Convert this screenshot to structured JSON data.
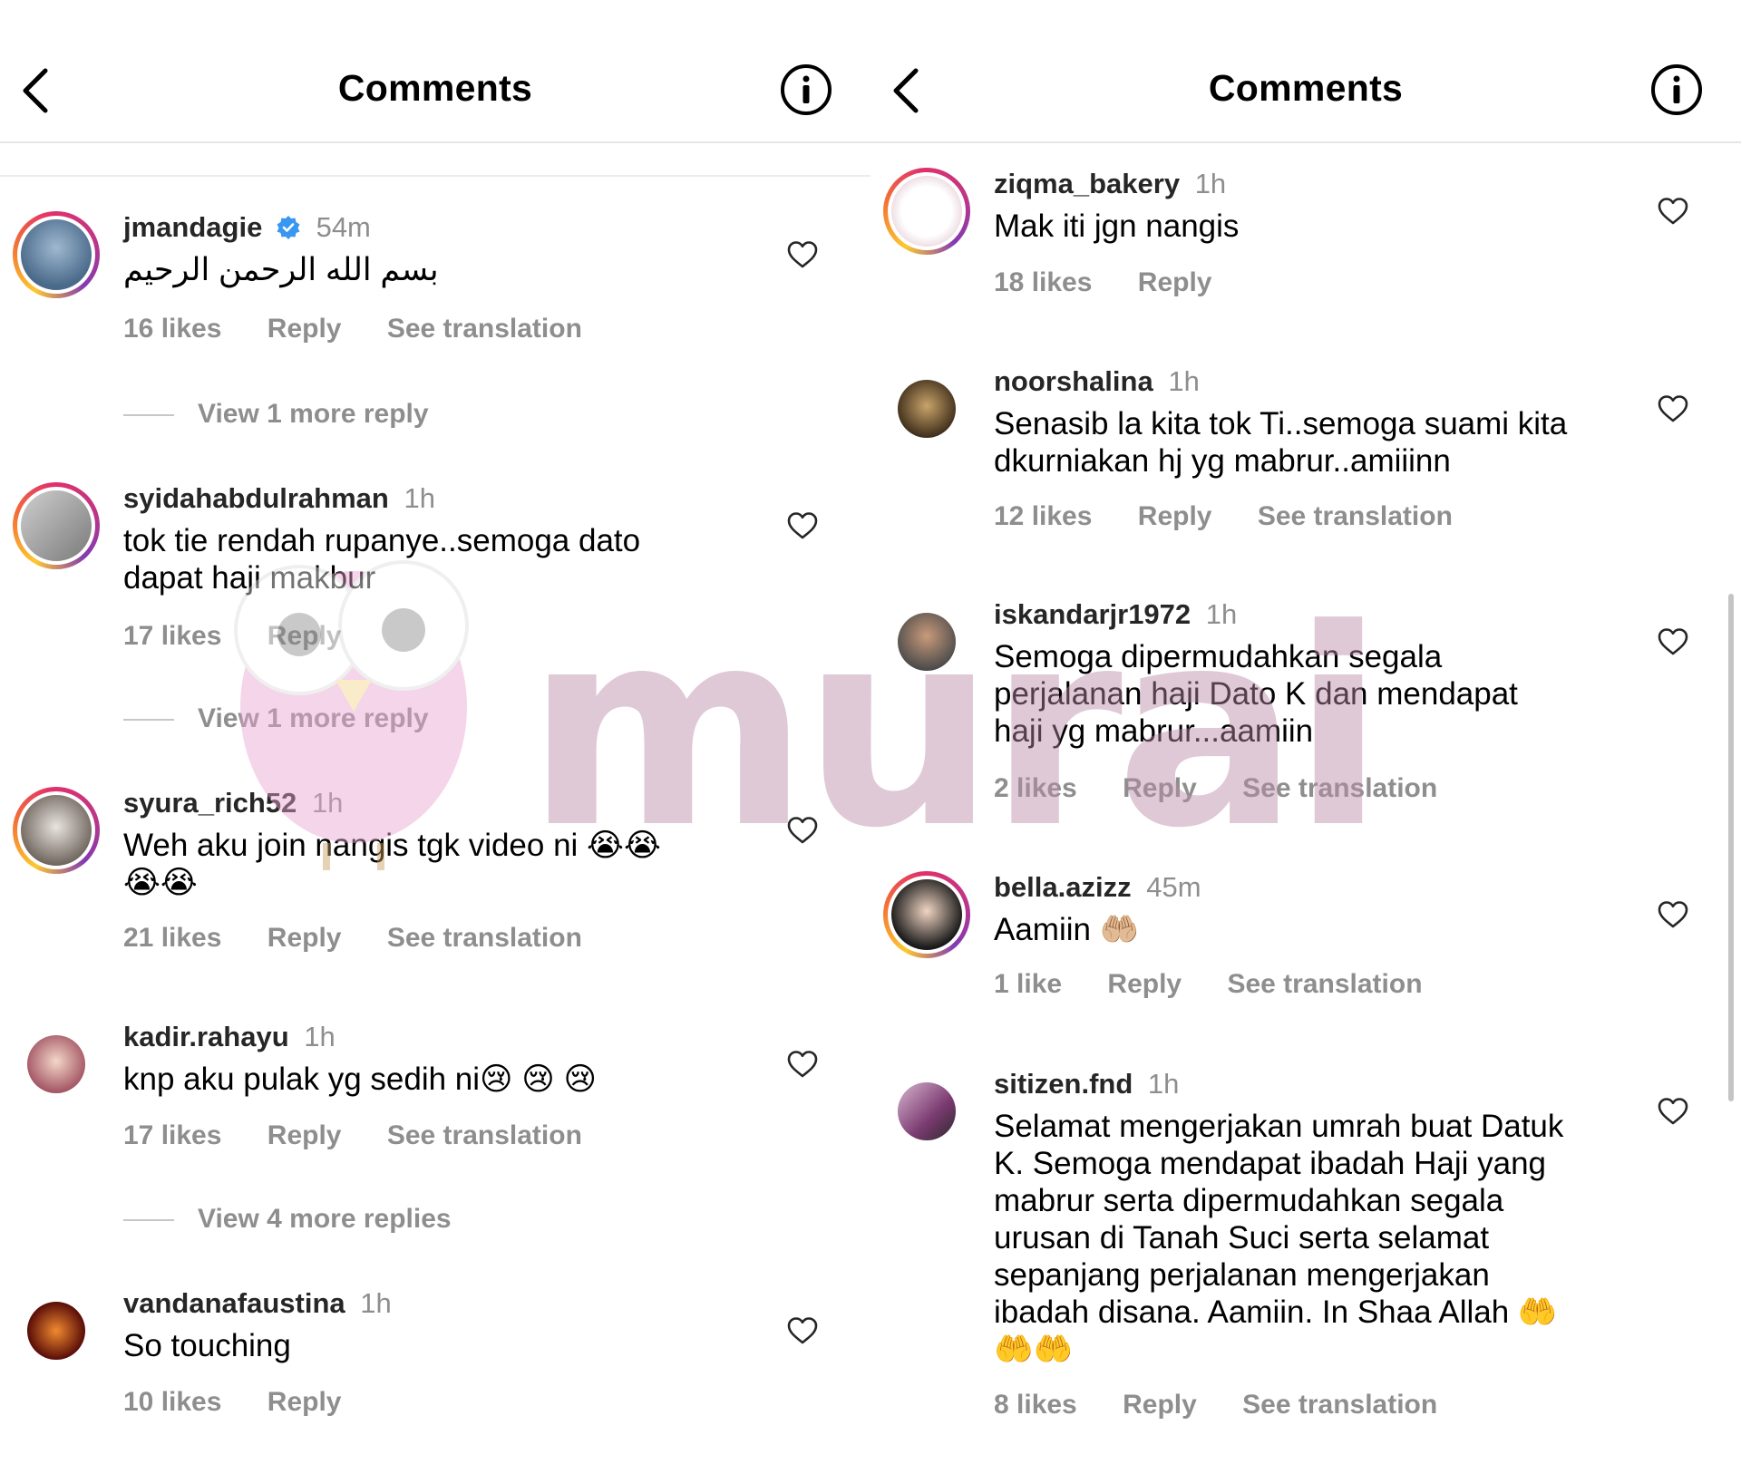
{
  "left": {
    "title": "Comments",
    "comments": [
      {
        "username": "jmandagie",
        "time": "54m",
        "text": "بسم الله الرحمن الرحيم",
        "likes": "16 likes",
        "reply": "Reply",
        "translation": "See translation",
        "view_more": "View 1 more reply"
      },
      {
        "username": "syidahabdulrahman",
        "time": "1h",
        "text": "tok tie rendah rupanye..semoga dato dapat haji makbur",
        "likes": "17 likes",
        "reply": "Reply",
        "view_more": "View 1 more reply"
      },
      {
        "username": "syura_rich52",
        "time": "1h",
        "text": "Weh aku join nangis tgk video ni 😭😭 😭😭",
        "likes": "21 likes",
        "reply": "Reply",
        "translation": "See translation"
      },
      {
        "username": "kadir.rahayu",
        "time": "1h",
        "text": "knp aku pulak yg sedih ni😢 😢 😢",
        "likes": "17 likes",
        "reply": "Reply",
        "translation": "See translation",
        "view_more": "View 4 more replies"
      },
      {
        "username": "vandanafaustina",
        "time": "1h",
        "text": "So touching",
        "likes": "10 likes",
        "reply": "Reply"
      }
    ]
  },
  "right": {
    "title": "Comments",
    "comments": [
      {
        "username": "ziqma_bakery",
        "time": "1h",
        "text": "Mak iti jgn nangis",
        "likes": "18 likes",
        "reply": "Reply"
      },
      {
        "username": "noorshalina",
        "time": "1h",
        "text": "Senasib la kita tok Ti..semoga suami kita dkurniakan hj yg mabrur..amiiinn",
        "likes": "12 likes",
        "reply": "Reply",
        "translation": "See translation"
      },
      {
        "username": "iskandarjr1972",
        "time": "1h",
        "text": "Semoga dipermudahkan segala perjalanan haji Dato K dan mendapat haji yg mabrur...aamiin",
        "likes": "2 likes",
        "reply": "Reply",
        "translation": "See translation"
      },
      {
        "username": "bella.azizz",
        "time": "45m",
        "text": "Aamiin 🤲🏼",
        "likes": "1 like",
        "reply": "Reply",
        "translation": "See translation"
      },
      {
        "username": "sitizen.fnd",
        "time": "1h",
        "text": "Selamat mengerjakan umrah buat Datuk K. Semoga mendapat ibadah Haji yang mabrur serta dipermudahkan segala urusan di Tanah Suci serta selamat sepanjang perjalanan mengerjakan ibadah disana. Aamiin. In Shaa Allah 🤲 🤲🤲",
        "likes": "8 likes",
        "reply": "Reply",
        "translation": "See translation"
      }
    ]
  },
  "watermark": {
    "text": "murai"
  },
  "colors": {
    "secondary_text": "#8e8e8e",
    "verified": "#3897f0",
    "watermark": "#b98aa8"
  },
  "icons": {
    "back": "chevron-left-icon",
    "info": "info-icon",
    "like": "heart-icon",
    "verified": "verified-badge-icon"
  }
}
